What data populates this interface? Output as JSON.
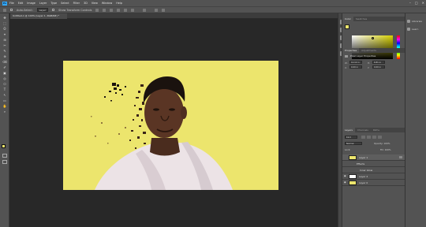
{
  "app": {
    "logo": "Ps"
  },
  "menu": [
    "File",
    "Edit",
    "Image",
    "Layer",
    "Type",
    "Select",
    "Filter",
    "3D",
    "View",
    "Window",
    "Help"
  ],
  "window_controls": [
    "–",
    "□",
    "✕"
  ],
  "options": {
    "auto_select_label": "Auto-Select:",
    "auto_select_value": "Layer",
    "transform_label": "Show Transform Controls"
  },
  "document": {
    "tab_title": "Untitled-1 @ 100% (Layer 1, RGB/8#) *"
  },
  "tools": [
    "✥",
    "⬚",
    "ʘ",
    "⌖",
    "⊞",
    "✂",
    "✎",
    "⊕",
    "⌫",
    "✐",
    "▣",
    "◎",
    "⎔",
    "T",
    "↖",
    "▭",
    "✋",
    "⌕"
  ],
  "panels": {
    "color_tabs": [
      "Color",
      "Swatches"
    ],
    "colors": {
      "foreground": "#ece56d",
      "background": "#ffffff",
      "accent": "#31a8ff"
    },
    "properties_tabs": [
      "Properties",
      "Adjustments"
    ],
    "properties_title": "Pixel Layer Properties",
    "fields": {
      "w_label": "W:",
      "w_value": "12.12 in",
      "h_label": "H:",
      "h_value": "6.81 in",
      "x_label": "X:",
      "x_value": "0.00 in",
      "y_label": "Y:",
      "y_value": "0.00 in"
    },
    "layers_tabs": [
      "Layers",
      "Channels",
      "Paths"
    ],
    "kind_label": "Kind",
    "blend_mode": "Normal",
    "opacity_label": "Opacity: 100%",
    "lock_label": "Lock:",
    "fill_label": "Fill: 100%",
    "layers": [
      {
        "name": "Layer 1",
        "visible": false
      },
      {
        "name": "Effects",
        "visible": false
      },
      {
        "name": "Inner Glow",
        "visible": false
      },
      {
        "name": "Layer 2",
        "visible": true
      },
      {
        "name": "Layer 0",
        "visible": true
      }
    ],
    "dock_labels": [
      "Libraries",
      "Learn"
    ]
  }
}
